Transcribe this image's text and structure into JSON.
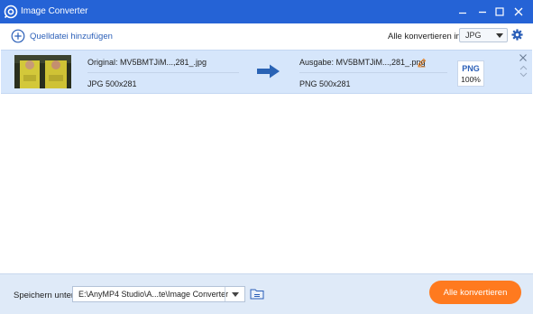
{
  "window": {
    "title": "Image Converter",
    "icons": {
      "logo": "app-logo-icon",
      "minimize": "minimize-icon",
      "maximize": "maximize-icon",
      "close": "close-icon"
    }
  },
  "toolbar": {
    "add_label": "Quelldatei hinzufügen",
    "add_icon": "plus-circle-icon",
    "convert_all_label": "Alle konvertieren in:",
    "format_value": "JPG",
    "settings_icon": "gear-icon"
  },
  "file": {
    "original_name": "Original: MV5BMTJiM...,281_.jpg",
    "original_info": "JPG   500x281",
    "output_name": "Ausgabe: MV5BMTJiM...,281_.png",
    "output_info": "PNG   500x281",
    "badge_format": "PNG",
    "badge_quality": "100%",
    "icons": {
      "arrow": "arrow-right-icon",
      "edit": "pencil-icon",
      "remove": "close-icon",
      "up": "chevron-up-icon",
      "down": "chevron-down-icon"
    }
  },
  "bottom": {
    "save_label": "Speichern unter:",
    "path_value": "E:\\AnyMP4 Studio\\A...te\\Image Converter",
    "folder_icon": "folder-icon",
    "convert_label": "Alle konvertieren"
  },
  "colors": {
    "titlebar": "#2563d6",
    "row_bg": "#d6e6fb",
    "bottom_bg": "#dfeaf8",
    "accent": "#ff7a1f",
    "link": "#2b5fb8"
  }
}
